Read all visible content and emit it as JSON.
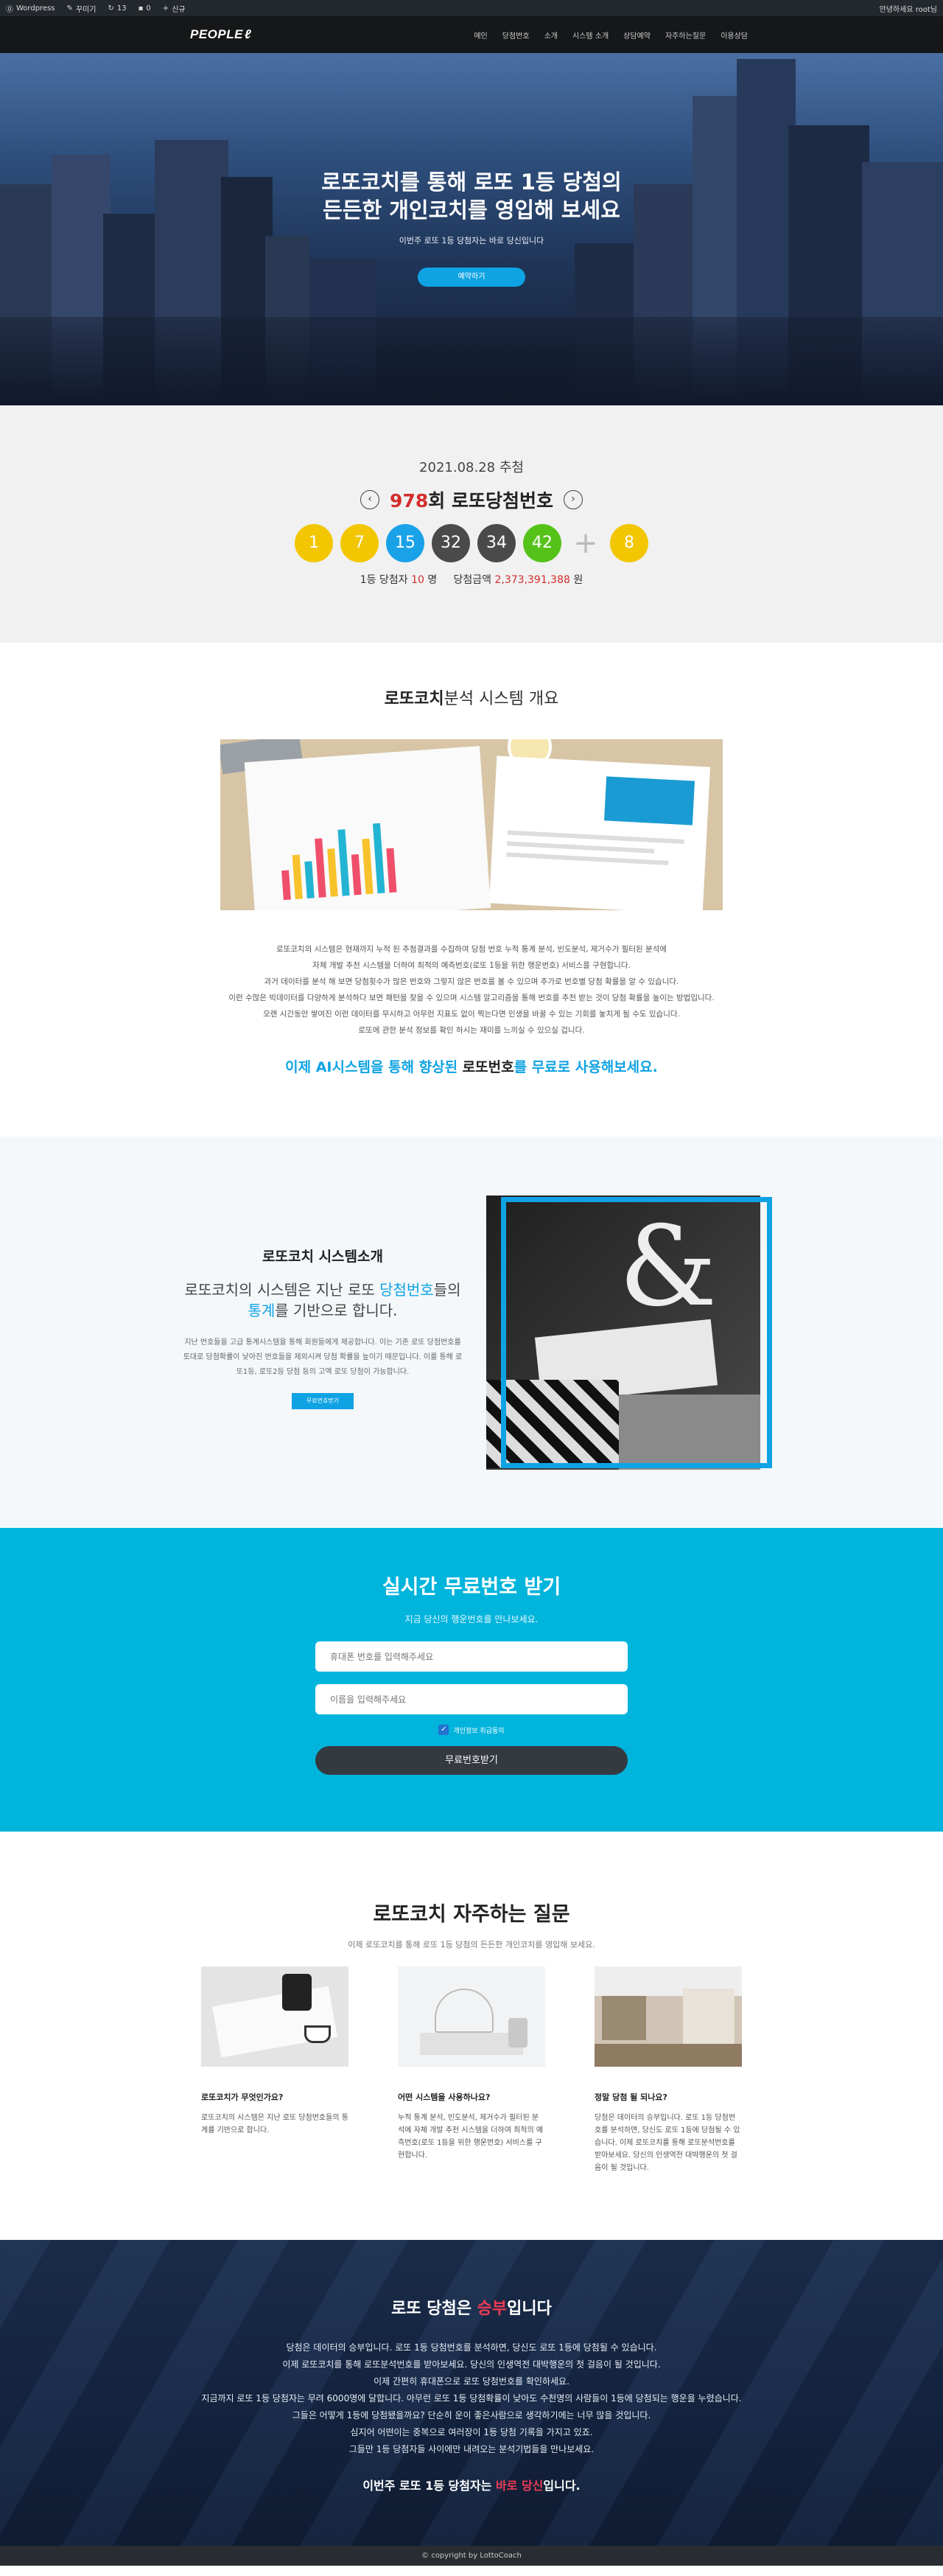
{
  "adminbar": {
    "wp_label": "Wordpress",
    "customize": "꾸미기",
    "updates": "13",
    "comments": "0",
    "new": "신규",
    "user": "안녕하세요 root님"
  },
  "nav": {
    "logo": "PEOPLE",
    "items": [
      "메인",
      "당첨번호",
      "소개",
      "시스템 소개",
      "상담예약",
      "자주하는질문",
      "이용상담"
    ]
  },
  "hero": {
    "title_line1": "로또코치를 통해 로또 1등 당첨의",
    "title_line2": "든든한 개인코치를 영입해 보세요",
    "subtitle": "이번주 로또 1등 당첨자는 바로 당신입니다",
    "cta": "예약하기"
  },
  "lotto": {
    "date": "2021.08.28 추첨",
    "round_number": "978",
    "round_suffix": "회 로또당첨번호",
    "prev_icon": "chevron-left",
    "next_icon": "chevron-right",
    "balls": [
      {
        "num": "1",
        "color": "#f2c600"
      },
      {
        "num": "7",
        "color": "#f2c600"
      },
      {
        "num": "15",
        "color": "#1aa2e8"
      },
      {
        "num": "32",
        "color": "#4a4a4a"
      },
      {
        "num": "34",
        "color": "#4a4a4a"
      },
      {
        "num": "42",
        "color": "#55c21a"
      }
    ],
    "plus": "+",
    "bonus": {
      "num": "8",
      "color": "#f2c600"
    },
    "winners_label": "1등 당첨자",
    "winners_count": "10",
    "winners_unit": "명",
    "prize_label": "당첨금액",
    "prize_amount": "2,373,391,388",
    "prize_unit": "원"
  },
  "overview": {
    "title_bold": "로또코치",
    "title_rest": "분석 시스템 개요",
    "lines": [
      "로또코치의 시스템은 현재까지 누적 된 추첨결과를 수집하여 당첨 번호 누적 통계 분석, 빈도분석, 제거수가 필터된 분석에",
      "자체 개발 추천 시스템을 더하여 최적의 예측번호(로또 1등을 위한 행운번호) 서비스를 구현합니다.",
      "과거 데이터를 분석 해 보면 당첨횟수가 많은 번호와 그렇지 않은 번호를 볼 수 있으며 추가로 번호별 당첨 확률을 알 수 있습니다.",
      "이런 수많은 빅데이터를 다양하게 분석하다 보면 패턴을 찾을 수 있으며 시스템 알고리즘을 통해 번호를 추천 받는 것이 당첨 확률을 높이는 방법입니다.",
      "오랜 시간동안 쌓여진 이런 데이터를 무시하고 아무런 지표도 없이 찍는다면 인생을 바꿀 수 있는 기회를 놓치게 될 수도 있습니다.",
      "로또에 관한 분석 정보를 확인 하시는 재미를 느끼실 수 있으실 겁니다."
    ],
    "tag_a": "이제 AI시스템을 통해 향상된 ",
    "tag_b": "로또번호",
    "tag_c": "를 무료로 사용해보세요."
  },
  "intro": {
    "title": "로또코치 시스템소개",
    "lead_a": "로또코치의 시스템은 지난 로또 ",
    "lead_b": "당첨번호",
    "lead_c": "들의 ",
    "lead_d": "통계",
    "lead_e": "를 기반으로 합니다.",
    "body": "지난 번호들을 고급 통계시스템을 통해 회원들에게 제공합니다. 이는 기존 로또 당첨번호를 토대로 당첨확률이 낮아진 번호들을 제외시켜 당첨 확률을 높이기 때문입니다. 이를 통해 로또1등, 로또2등 당첨 등의 고액 로또 당첨이 가능합니다.",
    "button": "무료번호받기"
  },
  "free": {
    "title": "실시간 무료번호 받기",
    "subtitle": "지금 당신의 행운번호를 만나보세요.",
    "phone_placeholder": "휴대폰 번호를 입력해주세요",
    "name_placeholder": "이름을 입력해주세요",
    "consent": "개인정보 취급동의",
    "submit": "무료번호받기"
  },
  "faq": {
    "title": "로또코치 자주하는 질문",
    "subtitle": "이제 로또코치를 통해 로또 1등 당첨의 든든한 개인코치를 영입해 보세요.",
    "items": [
      {
        "q": "로또코치가 무엇인가요?",
        "a": "로또코치의 시스템은 지난 로또 당첨번호들의 통계를 기반으로 합니다."
      },
      {
        "q": "어떤 시스템을 사용하나요?",
        "a": "누적 통계 분석, 빈도분석, 제거수가 필터된 분석에 자체 개발 추천 시스템을 더하여 최적의 예측번호(로또 1등을 위한 행운번호) 서비스를 구현합니다."
      },
      {
        "q": "정말 당첨 될 되나요?",
        "a": "당첨은 데이터의 승부입니다. 로또 1등 당첨번호를 분석하면, 당신도 로또 1등에 당첨될 수 있습니다. 이제 로또코치를 통해 로또분석번호를 받아보세요. 당신의 인생역전 대박행운의 첫 걸음이 될 것입니다."
      }
    ]
  },
  "bottom": {
    "title_a": "로또 당첨은 ",
    "title_b": "승부",
    "title_c": "입니다",
    "lines": [
      "당첨은 데이터의 승부입니다. 로또 1등 당첨번호를 분석하면, 당신도 로또 1등에 당첨될 수 있습니다.",
      "이제 로또코치를 통해 로또분석번호를 받아보세요. 당신의 인생역전 대박행운의 첫 걸음이 될 것입니다.",
      "이제 간편히 휴대폰으로 로또 당첨번호를 확인하세요.",
      "지금까지 로또 1등 당첨자는 무려 6000명에 달합니다. 아무런 로또 1등 당첨확률이 낮아도 수천명의 사람들이 1등에 당첨되는 행운을 누렸습니다.",
      "그들은 어떻게 1등에 당첨됐을까요? 단순히 운이 좋은사람으로 생각하기에는 너무 많을 것입니다.",
      "심지어 어떤이는 중복으로 여러장이 1등 당첨 기록을 가지고 있죠.",
      "그들만 1등 당첨자들 사이에만 내려오는 분석기법들을 만나보세요."
    ],
    "final_a": "이번주 로또 1등 당첨자는 ",
    "final_b": "바로 당신",
    "final_c": "입니다."
  },
  "footer": {
    "text": "© copyright by LottoCoach"
  }
}
